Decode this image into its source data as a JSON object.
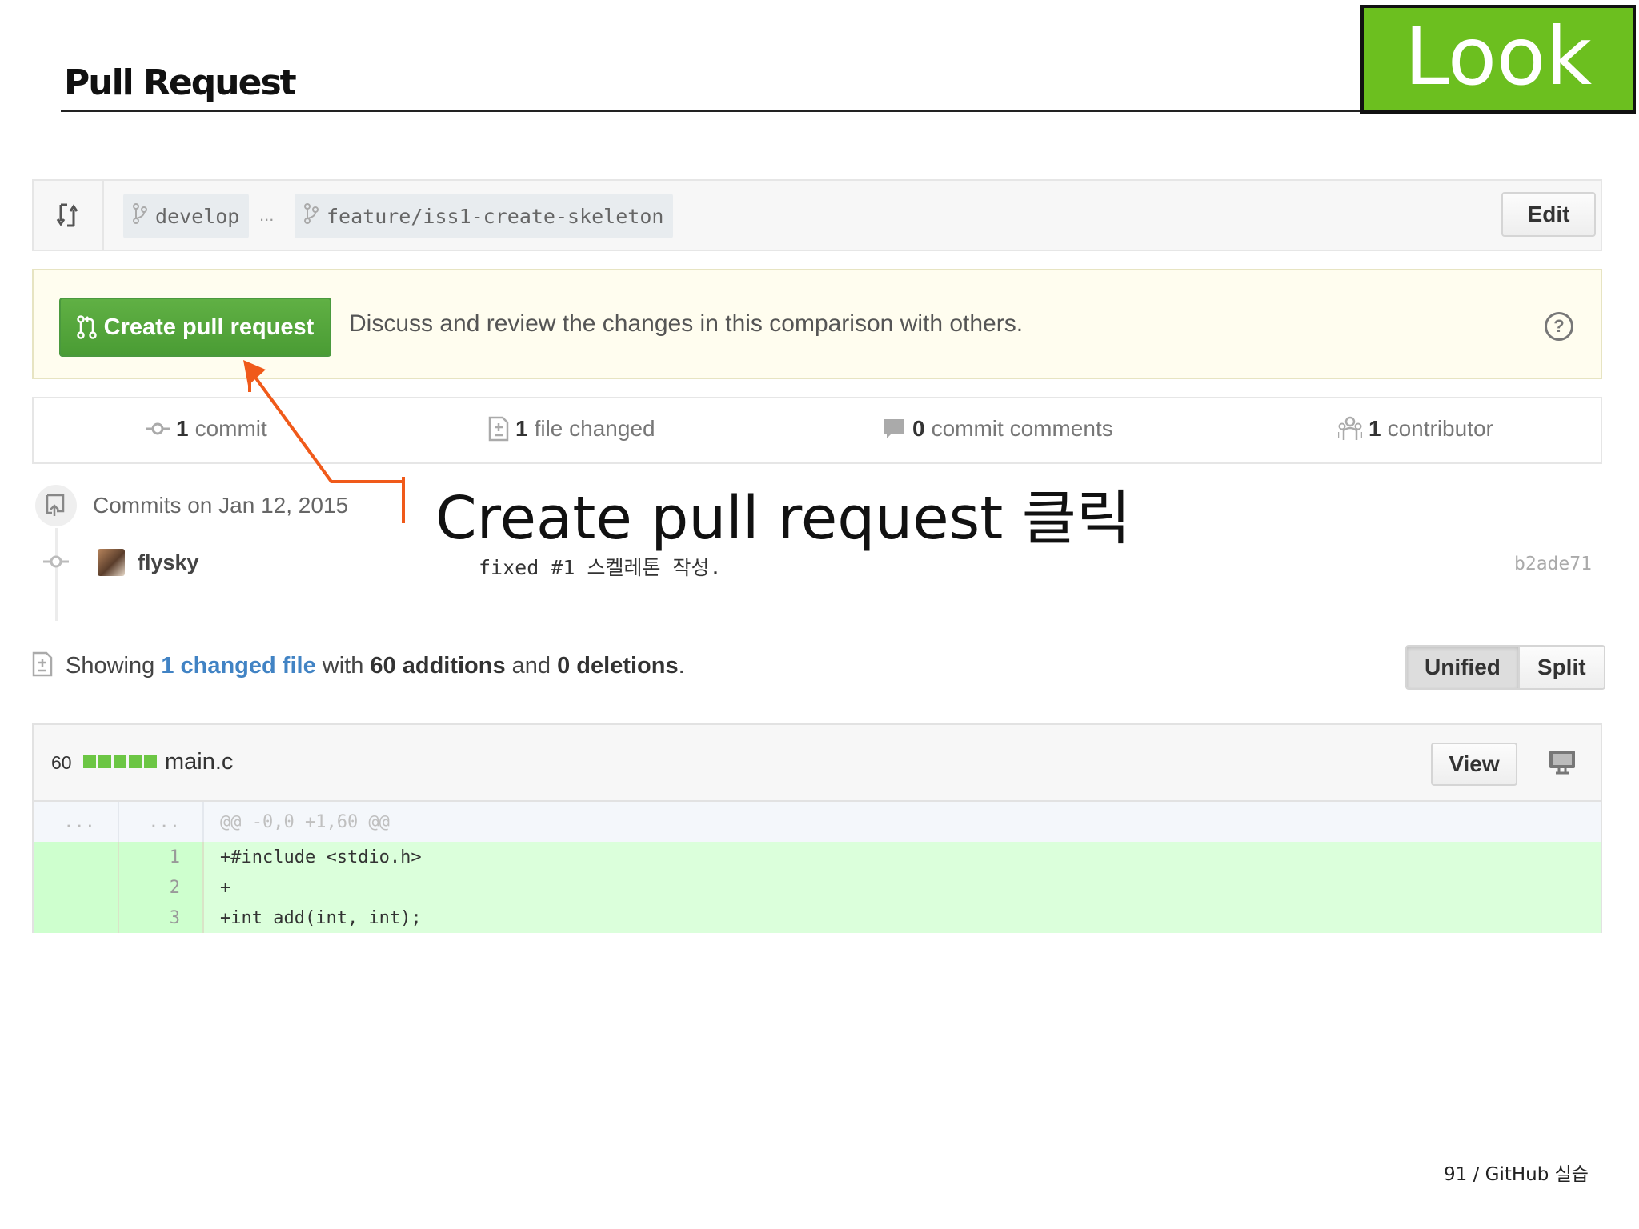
{
  "slide": {
    "title": "Pull Request",
    "badge": "Look",
    "footer": "91 / GitHub 실습"
  },
  "range": {
    "base_branch": "develop",
    "separator": "...",
    "compare_branch": "feature/iss1-create-skeleton",
    "edit_label": "Edit"
  },
  "pr_banner": {
    "button_label": "Create pull request",
    "description": "Discuss and review the changes in this comparison with others.",
    "help_glyph": "?"
  },
  "stats": {
    "commits_count": "1",
    "commits_label": "commit",
    "files_count": "1",
    "files_label": "file changed",
    "comments_count": "0",
    "comments_label": "commit comments",
    "contributors_count": "1",
    "contributors_label": "contributor"
  },
  "commits": {
    "date_heading": "Commits on Jan 12, 2015",
    "items": [
      {
        "author": "flysky",
        "message": "fixed #1 스켈레톤 작성.",
        "sha": "b2ade71"
      }
    ]
  },
  "annotation": {
    "text": "Create pull request 클릭",
    "color": "#f05a1a"
  },
  "summary": {
    "prefix": "Showing",
    "changed_link": "1 changed file",
    "with": "with",
    "additions": "60 additions",
    "and": "and",
    "deletions": "0 deletions",
    "suffix": ".",
    "view_modes": [
      "Unified",
      "Split"
    ],
    "selected_mode": "Unified"
  },
  "file": {
    "diffstat_count": "60",
    "diffstat_added_blocks": 5,
    "name": "main.c",
    "view_label": "View",
    "hunk": {
      "old_ln": "...",
      "new_ln": "...",
      "text": "@@ -0,0 +1,60 @@"
    },
    "lines": [
      {
        "ln": "1",
        "code": "+#include <stdio.h>"
      },
      {
        "ln": "2",
        "code": "+"
      },
      {
        "ln": "3",
        "code": "+int add(int, int);"
      }
    ]
  },
  "colors": {
    "badge_green": "#6cbf1f",
    "button_green": "#55a532",
    "link_blue": "#4183c4",
    "addition_bg": "#dbffdb",
    "banner_bg": "#fffdef"
  }
}
